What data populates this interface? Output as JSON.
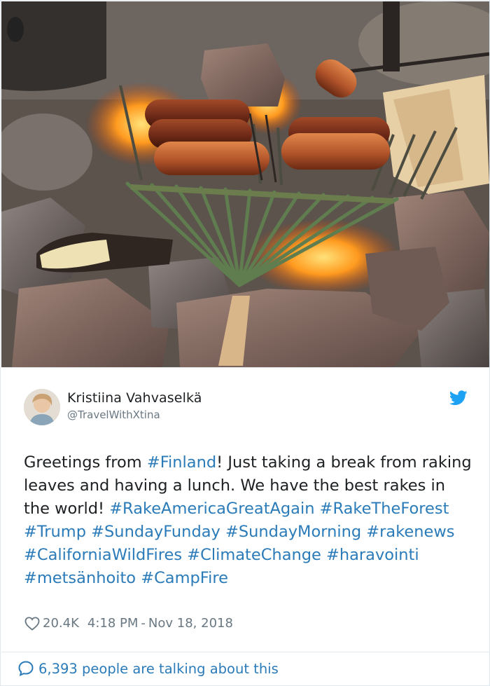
{
  "tweet": {
    "author": {
      "name": "Kristiina Vahvaselkä",
      "handle": "@TravelWithXtina"
    },
    "text_segments": [
      {
        "text": "Greetings from ",
        "tag": false
      },
      {
        "text": "#Finland",
        "tag": true
      },
      {
        "text": "! Just taking a break from raking leaves and having a lunch. We have the best rakes in the world! ",
        "tag": false
      },
      {
        "text": "#RakeAmericaGreatAgain",
        "tag": true
      },
      {
        "text": " ",
        "tag": false
      },
      {
        "text": "#RakeTheForest",
        "tag": true
      },
      {
        "text": " ",
        "tag": false
      },
      {
        "text": "#Trump",
        "tag": true
      },
      {
        "text": " ",
        "tag": false
      },
      {
        "text": "#SundayFunday",
        "tag": true
      },
      {
        "text": " ",
        "tag": false
      },
      {
        "text": "#SundayMorning",
        "tag": true
      },
      {
        "text": " ",
        "tag": false
      },
      {
        "text": "#rakenews",
        "tag": true
      },
      {
        "text": " ",
        "tag": false
      },
      {
        "text": "#CaliforniaWildFires",
        "tag": true
      },
      {
        "text": " ",
        "tag": false
      },
      {
        "text": "#ClimateChange",
        "tag": true
      },
      {
        "text": " ",
        "tag": false
      },
      {
        "text": "#haravointi",
        "tag": true
      },
      {
        "text": " ",
        "tag": false
      },
      {
        "text": "#metsänhoito",
        "tag": true
      },
      {
        "text": " ",
        "tag": false
      },
      {
        "text": "#CampFire",
        "tag": true
      }
    ],
    "likes": "20.4K",
    "time": "4:18 PM",
    "separator": "-",
    "date": "Nov 18, 2018",
    "talking": "6,393 people are talking about this"
  },
  "icons": {
    "brand": "twitter-bird-icon",
    "like": "heart-icon",
    "talk": "speech-bubble-icon"
  },
  "colors": {
    "link": "#2b7bb9",
    "text": "#1c2022",
    "muted": "#697882",
    "bird": "#1da1f2",
    "border": "#e1e8ed"
  }
}
